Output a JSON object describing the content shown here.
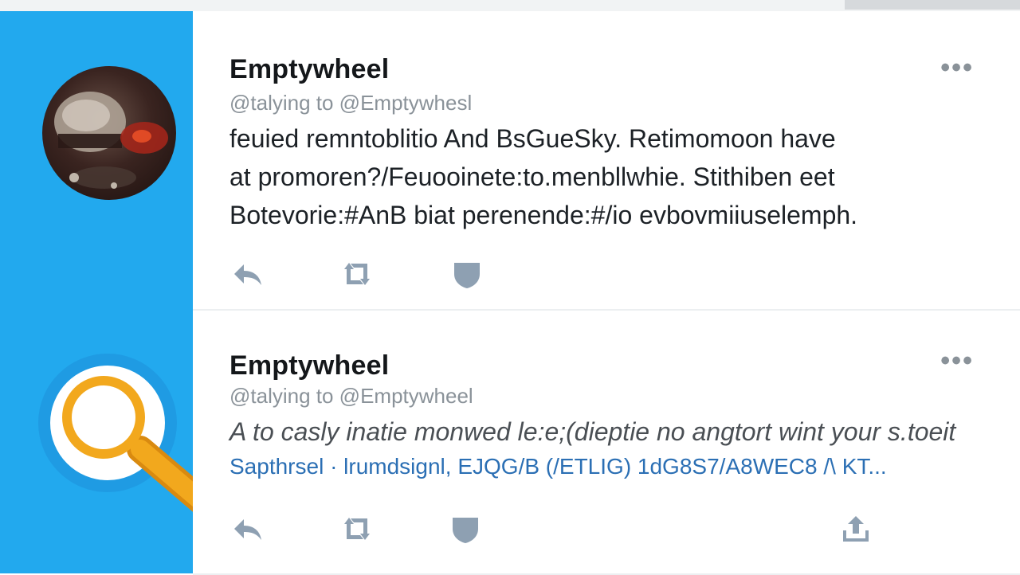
{
  "colors": {
    "sidebar": "#22a9ee",
    "search_ring": "#1f9be3",
    "search_handle": "#f2a81d",
    "icon_gray": "#8ea0b2"
  },
  "icons": {
    "reply": "reply-icon",
    "retweet": "retweet-icon",
    "like": "shield-icon",
    "share": "share-icon",
    "more": "more-dots-icon",
    "search": "search-icon"
  },
  "tweets": [
    {
      "author": "Emptywheel",
      "handle": "@talying to @Emptywhesl",
      "more": "•••",
      "lines": [
        "feuied remntoblitio And BsGueSky. Retimomoon have",
        "at promoren?/Feuooinete:to.menbllwhie. Stithiben eet",
        "Botevorie:#AnB biat perenende:#/io evbovmiiuselemph."
      ]
    },
    {
      "author": "Emptywheel",
      "handle": "@talying to @Emptywheel",
      "more": "•••",
      "lines": [
        "A to casly inatie monwed le:e;(dieptie no angtort wint your s.toeit",
        "Sapthrsel · lrumdsignl, EJQG/B (/ETLIG) 1dG8S7/A8WEC8 /\\ KT..."
      ]
    }
  ]
}
